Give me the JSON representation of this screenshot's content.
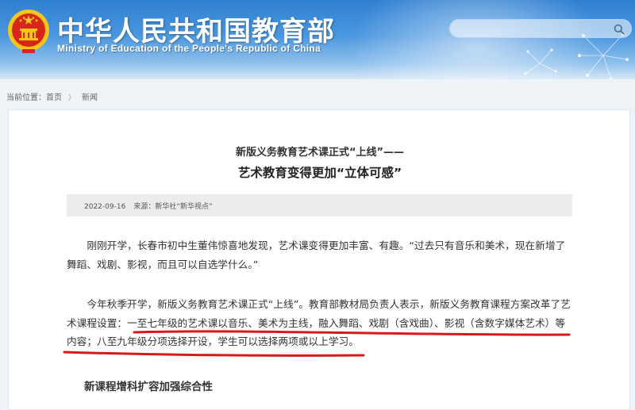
{
  "header": {
    "title": "中华人民共和国教育部",
    "subtitle": "Ministry of Education of the People's Republic of China",
    "search": {
      "placeholder": "",
      "value": ""
    },
    "colors": {
      "top": "#2f7fd0",
      "bottom": "#d7e8f7",
      "emblem_red": "#d8261c",
      "emblem_gold": "#f5c518"
    }
  },
  "breadcrumb": {
    "label": "当前位置：",
    "items": [
      "首页",
      "新闻"
    ]
  },
  "article": {
    "subtitle": "新版义务教育艺术课正式“上线”——",
    "title": "艺术教育变得更加“立体可感”",
    "date": "2022-09-16",
    "source": "来源：新华社“新华视点”",
    "paragraphs": [
      "刚刚开学，长春市初中生董伟惊喜地发现，艺术课变得更加丰富、有趣。“过去只有音乐和美术，现在新增了舞蹈、戏剧、影视，而且可以自选学什么。”",
      "今年秋季开学，新版义务教育艺术课正式“上线”。教育部教材局负责人表示，新版义务教育课程方案改革了艺术课程设置：一至七年级的艺术课以音乐、美术为主线，融入舞蹈、戏剧（含戏曲）、影视（含数字媒体艺术）等内容；八至九年级分项选择开设，学生可以选择两项或以上学习。"
    ],
    "section_heading": "新课程增科扩容加强综合性",
    "annotation_color": "#d61a1a"
  }
}
